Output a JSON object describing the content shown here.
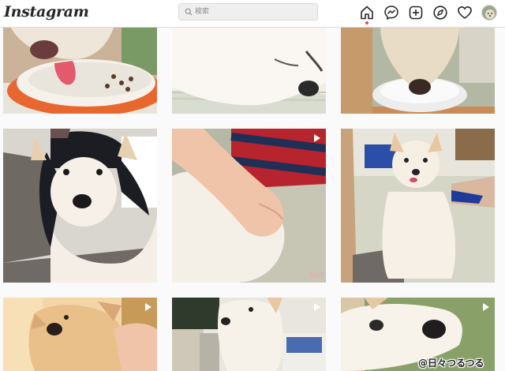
{
  "app": {
    "logo_text": "Instagram"
  },
  "search": {
    "placeholder": "検索",
    "value": ""
  },
  "nav": [
    "home-icon",
    "messenger-icon",
    "new-post-icon",
    "explore-icon",
    "heart-icon",
    "profile-avatar"
  ],
  "grid": {
    "tiles": [
      {
        "id": "tile-1",
        "type": "image"
      },
      {
        "id": "tile-2",
        "type": "image"
      },
      {
        "id": "tile-3",
        "type": "image"
      },
      {
        "id": "tile-4",
        "type": "image"
      },
      {
        "id": "tile-5",
        "type": "video",
        "overlay_text": "ked"
      },
      {
        "id": "tile-6",
        "type": "image"
      },
      {
        "id": "tile-7",
        "type": "video"
      },
      {
        "id": "tile-8",
        "type": "video"
      },
      {
        "id": "tile-9",
        "type": "video"
      }
    ]
  },
  "watermark": {
    "text": "@日々つるつる"
  },
  "colors": {
    "accent_dot": "#ed4956",
    "text_primary": "#262626",
    "muted": "#8e8e8e"
  }
}
